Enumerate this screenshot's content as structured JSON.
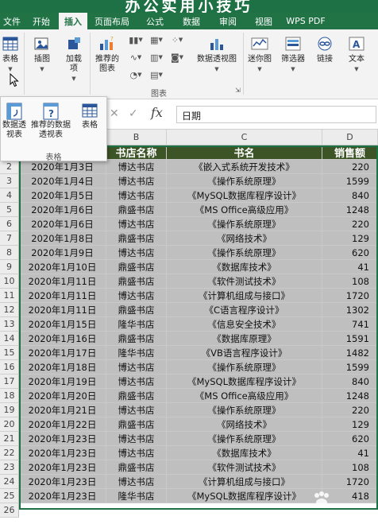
{
  "banner": {
    "title": "办公实用小技巧"
  },
  "tabs": [
    {
      "label": "文件",
      "width": 30
    },
    {
      "label": "开始",
      "width": 44
    },
    {
      "label": "插入",
      "width": 36,
      "active": true
    },
    {
      "label": "页面布局",
      "width": 62
    },
    {
      "label": "公式",
      "width": 46
    },
    {
      "label": "数据",
      "width": 46
    },
    {
      "label": "审阅",
      "width": 46
    },
    {
      "label": "视图",
      "width": 44
    },
    {
      "label": "WPS PDF",
      "width": 62
    }
  ],
  "ribbon": {
    "tables_label": "表格",
    "illustrations_label": "插图",
    "addins_label": "加载项",
    "recommended_charts_label": "推荐的图表",
    "pivot_chart_label": "数据透视图",
    "sparklines_label": "迷你图",
    "filter_label": "筛选器",
    "link_label": "链接",
    "text_label": "文本",
    "charts_group_label": "图表"
  },
  "formula_bar": {
    "value": "日期"
  },
  "popup": {
    "pivot_table_label": "数据透视表",
    "recommended_pivot_label": "推荐的数据透视表",
    "table_label": "表格",
    "group_label": "表格"
  },
  "columns": [
    "B",
    "C",
    "D"
  ],
  "headers": {
    "date": "",
    "store": "书店名称",
    "book": "书名",
    "sales": "销售额"
  },
  "rows": [
    {
      "n": "2",
      "date": "2020年1月3日",
      "store": "博达书店",
      "book": "《嵌入式系统开发技术》",
      "sales": "220"
    },
    {
      "n": "3",
      "date": "2020年1月4日",
      "store": "博达书店",
      "book": "《操作系统原理》",
      "sales": "1599"
    },
    {
      "n": "4",
      "date": "2020年1月5日",
      "store": "博达书店",
      "book": "《MySQL数据库程序设计》",
      "sales": "840"
    },
    {
      "n": "5",
      "date": "2020年1月6日",
      "store": "鼎盛书店",
      "book": "《MS Office高级应用》",
      "sales": "1248"
    },
    {
      "n": "6",
      "date": "2020年1月6日",
      "store": "博达书店",
      "book": "《操作系统原理》",
      "sales": "220"
    },
    {
      "n": "7",
      "date": "2020年1月8日",
      "store": "鼎盛书店",
      "book": "《网络技术》",
      "sales": "129"
    },
    {
      "n": "8",
      "date": "2020年1月9日",
      "store": "博达书店",
      "book": "《操作系统原理》",
      "sales": "620"
    },
    {
      "n": "9",
      "date": "2020年1月10日",
      "store": "鼎盛书店",
      "book": "《数据库技术》",
      "sales": "41"
    },
    {
      "n": "10",
      "date": "2020年1月11日",
      "store": "鼎盛书店",
      "book": "《软件测试技术》",
      "sales": "108"
    },
    {
      "n": "11",
      "date": "2020年1月11日",
      "store": "博达书店",
      "book": "《计算机组成与接口》",
      "sales": "1720"
    },
    {
      "n": "12",
      "date": "2020年1月11日",
      "store": "鼎盛书店",
      "book": "《C语言程序设计》",
      "sales": "1302"
    },
    {
      "n": "13",
      "date": "2020年1月15日",
      "store": "隆华书店",
      "book": "《信息安全技术》",
      "sales": "741"
    },
    {
      "n": "14",
      "date": "2020年1月16日",
      "store": "鼎盛书店",
      "book": "《数据库原理》",
      "sales": "1591"
    },
    {
      "n": "15",
      "date": "2020年1月17日",
      "store": "隆华书店",
      "book": "《VB语言程序设计》",
      "sales": "1482"
    },
    {
      "n": "16",
      "date": "2020年1月18日",
      "store": "博达书店",
      "book": "《操作系统原理》",
      "sales": "1599"
    },
    {
      "n": "17",
      "date": "2020年1月19日",
      "store": "博达书店",
      "book": "《MySQL数据库程序设计》",
      "sales": "840"
    },
    {
      "n": "18",
      "date": "2020年1月20日",
      "store": "鼎盛书店",
      "book": "《MS Office高级应用》",
      "sales": "1248"
    },
    {
      "n": "19",
      "date": "2020年1月21日",
      "store": "博达书店",
      "book": "《操作系统原理》",
      "sales": "220"
    },
    {
      "n": "20",
      "date": "2020年1月22日",
      "store": "鼎盛书店",
      "book": "《网络技术》",
      "sales": "129"
    },
    {
      "n": "21",
      "date": "2020年1月23日",
      "store": "博达书店",
      "book": "《操作系统原理》",
      "sales": "620"
    },
    {
      "n": "22",
      "date": "2020年1月23日",
      "store": "博达书店",
      "book": "《数据库技术》",
      "sales": "41"
    },
    {
      "n": "23",
      "date": "2020年1月23日",
      "store": "鼎盛书店",
      "book": "《软件测试技术》",
      "sales": "108"
    },
    {
      "n": "24",
      "date": "2020年1月23日",
      "store": "博达书店",
      "book": "《计算机组成与接口》",
      "sales": "1720"
    },
    {
      "n": "25",
      "date": "2020年1月23日",
      "store": "隆华书店",
      "book": "《MySQL数据库程序设计》",
      "sales": "418"
    }
  ],
  "empty_row": "26",
  "colors": {
    "brand": "#217346",
    "header_fill": "#3d5426",
    "row_fill": "#bfbfbf"
  }
}
